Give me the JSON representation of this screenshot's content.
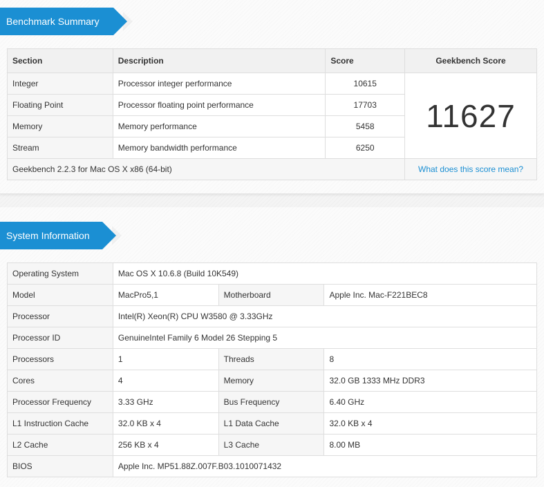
{
  "benchmark": {
    "title": "Benchmark Summary",
    "headers": {
      "section": "Section",
      "description": "Description",
      "score": "Score",
      "geekbench_score": "Geekbench Score"
    },
    "rows": [
      {
        "section": "Integer",
        "description": "Processor integer performance",
        "score": "10615"
      },
      {
        "section": "Floating Point",
        "description": "Processor floating point performance",
        "score": "17703"
      },
      {
        "section": "Memory",
        "description": "Memory performance",
        "score": "5458"
      },
      {
        "section": "Stream",
        "description": "Memory bandwidth performance",
        "score": "6250"
      }
    ],
    "total": "11627",
    "version": "Geekbench 2.2.3 for Mac OS X x86 (64-bit)",
    "link": "What does this score mean?"
  },
  "system": {
    "title": "System Information",
    "os": {
      "label": "Operating System",
      "value": "Mac OS X 10.6.8 (Build 10K549)"
    },
    "model": {
      "label": "Model",
      "value": "MacPro5,1"
    },
    "motherboard": {
      "label": "Motherboard",
      "value": "Apple Inc. Mac-F221BEC8"
    },
    "processor": {
      "label": "Processor",
      "value": "Intel(R) Xeon(R) CPU W3580 @ 3.33GHz"
    },
    "processor_id": {
      "label": "Processor ID",
      "value": "GenuineIntel Family 6 Model 26 Stepping 5"
    },
    "processors": {
      "label": "Processors",
      "value": "1"
    },
    "threads": {
      "label": "Threads",
      "value": "8"
    },
    "cores": {
      "label": "Cores",
      "value": "4"
    },
    "memory": {
      "label": "Memory",
      "value": "32.0 GB 1333 MHz DDR3"
    },
    "proc_freq": {
      "label": "Processor Frequency",
      "value": "3.33 GHz"
    },
    "bus_freq": {
      "label": "Bus Frequency",
      "value": "6.40 GHz"
    },
    "l1i": {
      "label": "L1 Instruction Cache",
      "value": "32.0 KB x 4"
    },
    "l1d": {
      "label": "L1 Data Cache",
      "value": "32.0 KB x 4"
    },
    "l2": {
      "label": "L2 Cache",
      "value": "256 KB x 4"
    },
    "l3": {
      "label": "L3 Cache",
      "value": "8.00 MB"
    },
    "bios": {
      "label": "BIOS",
      "value": "Apple Inc. MP51.88Z.007F.B03.1010071432"
    }
  },
  "colors": {
    "accent": "#1b8fd3"
  }
}
